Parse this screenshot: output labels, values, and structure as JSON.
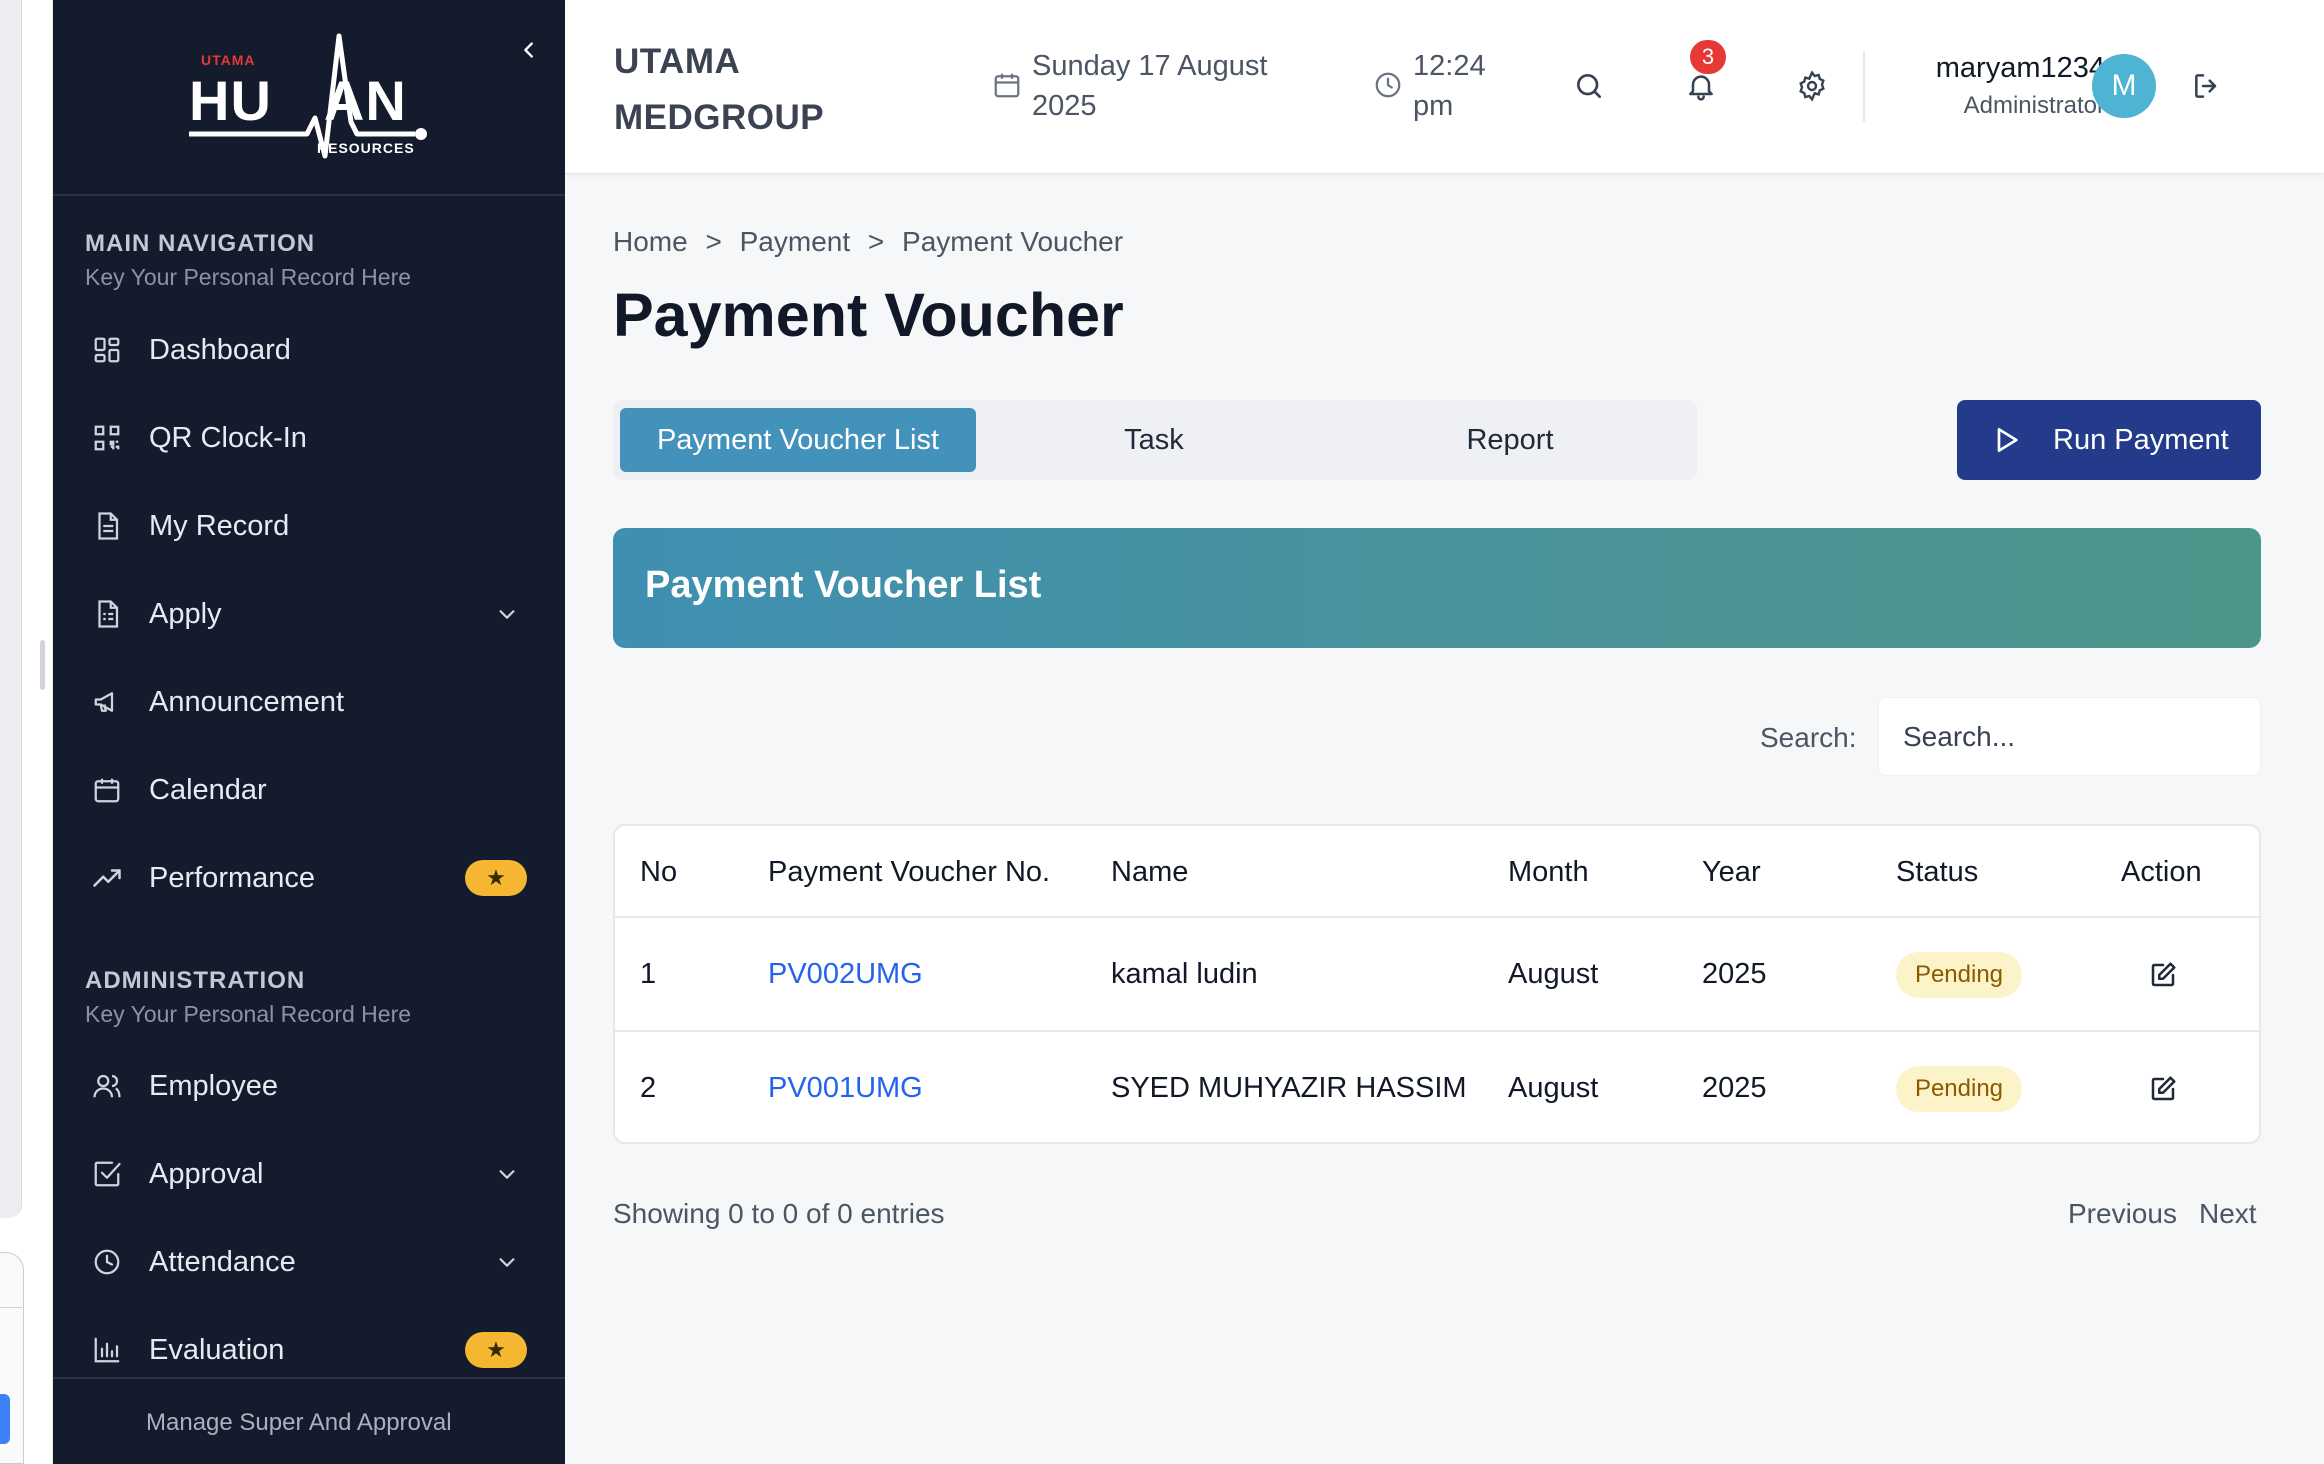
{
  "sidebar": {
    "logo": {
      "top_text": "UTAMA",
      "main_text": "HUMAN",
      "bottom_text": "RESOURCES"
    },
    "main_section": {
      "title": "MAIN NAVIGATION",
      "subtitle": "Key Your Personal Record Here"
    },
    "main_items": [
      {
        "label": "Dashboard",
        "icon": "dashboard-icon"
      },
      {
        "label": "QR Clock-In",
        "icon": "qr-code-icon"
      },
      {
        "label": "My Record",
        "icon": "document-icon"
      },
      {
        "label": "Apply",
        "icon": "form-icon",
        "has_dropdown": true
      },
      {
        "label": "Announcement",
        "icon": "megaphone-icon"
      },
      {
        "label": "Calendar",
        "icon": "calendar-icon"
      },
      {
        "label": "Performance",
        "icon": "trending-up-icon",
        "badge": "star"
      }
    ],
    "admin_section": {
      "title": "ADMINISTRATION",
      "subtitle": "Key Your Personal Record Here"
    },
    "admin_items": [
      {
        "label": "Employee",
        "icon": "users-icon"
      },
      {
        "label": "Approval",
        "icon": "check-square-icon",
        "has_dropdown": true
      },
      {
        "label": "Attendance",
        "icon": "clock-icon",
        "has_dropdown": true
      },
      {
        "label": "Evaluation",
        "icon": "bar-chart-icon",
        "badge": "star"
      }
    ],
    "footer_text": "Manage Super And Approval",
    "colors": {
      "background": "#141b2d",
      "badge": "#f5b731"
    }
  },
  "header": {
    "company": "UTAMA MEDGROUP",
    "date": "Sunday 17 August 2025",
    "time": "12:24 pm",
    "notification_count": "3",
    "user": {
      "name": "maryam1234",
      "role": "Administrator",
      "avatar_initial": "M"
    }
  },
  "breadcrumb": [
    "Home",
    ">",
    "Payment",
    ">",
    "Payment Voucher"
  ],
  "page_title": "Payment Voucher",
  "tabs": [
    {
      "label": "Payment Voucher List",
      "active": true
    },
    {
      "label": "Task",
      "active": false
    },
    {
      "label": "Report",
      "active": false
    }
  ],
  "run_payment_label": "Run Payment",
  "list_title": "Payment Voucher List",
  "search": {
    "label": "Search:",
    "placeholder": "Search..."
  },
  "table": {
    "columns": [
      "No",
      "Payment Voucher No.",
      "Name",
      "Month",
      "Year",
      "Status",
      "Action"
    ],
    "rows": [
      {
        "no": "1",
        "voucher": "PV002UMG",
        "name": "kamal ludin",
        "month": "August",
        "year": "2025",
        "status": "Pending"
      },
      {
        "no": "2",
        "voucher": "PV001UMG",
        "name": "SYED MUHYAZIR HASSIM",
        "month": "August",
        "year": "2025",
        "status": "Pending"
      }
    ]
  },
  "pagination": {
    "info": "Showing 0 to 0 of 0 entries",
    "previous": "Previous",
    "next": "Next"
  },
  "colors": {
    "accent": "#4392bb",
    "primary_button": "#243b8c",
    "link": "#2563eb",
    "pending_bg": "#fdf3c9",
    "notification": "#e53935"
  }
}
